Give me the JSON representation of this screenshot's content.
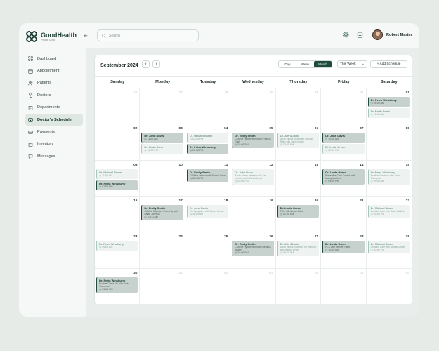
{
  "brand": {
    "name": "GoodHealth",
    "subtitle": "Private Clinic"
  },
  "nav": [
    {
      "label": "Dashboard",
      "icon": "grid-icon"
    },
    {
      "label": "Appointment",
      "icon": "calendar-icon"
    },
    {
      "label": "Patients",
      "icon": "users-icon"
    },
    {
      "label": "Doctors",
      "icon": "stethoscope-icon"
    },
    {
      "label": "Departments",
      "icon": "building-icon"
    },
    {
      "label": "Doctor's Schedule",
      "icon": "schedule-icon",
      "active": true
    },
    {
      "label": "Payments",
      "icon": "card-icon"
    },
    {
      "label": "Inventory",
      "icon": "box-icon"
    },
    {
      "label": "Messages",
      "icon": "chat-icon"
    }
  ],
  "search": {
    "placeholder": "Search"
  },
  "user": {
    "name": "Robert Martin"
  },
  "calendar": {
    "month_label": "September 2024",
    "views": [
      "Day",
      "Week",
      "Month"
    ],
    "active_view": "Month",
    "range_select": "This Week",
    "add_button": "+ Add Schedule",
    "weekdays": [
      "Sunday",
      "Monday",
      "Tuesday",
      "Wednesday",
      "Thursday",
      "Friday",
      "Saturday"
    ],
    "cells": [
      {
        "date": "26",
        "muted": true,
        "events": []
      },
      {
        "date": "27",
        "muted": true,
        "events": []
      },
      {
        "date": "28",
        "muted": true,
        "events": []
      },
      {
        "date": "29",
        "muted": true,
        "events": []
      },
      {
        "date": "30",
        "muted": true,
        "events": []
      },
      {
        "date": "31",
        "muted": true,
        "events": []
      },
      {
        "date": "01",
        "events": [
          {
            "doctor": "Dr. Petra Winsburry",
            "time": "09:00 AM",
            "style": "dark"
          },
          {
            "doctor": "Dr. Emily Smith",
            "time": "10:00 AM",
            "style": "light"
          }
        ]
      },
      {
        "date": "02",
        "events": []
      },
      {
        "date": "03",
        "events": [
          {
            "doctor": "Dr. John Davis",
            "time": "11:00 AM",
            "style": "dark"
          },
          {
            "doctor": "Dr. Linda Green",
            "time": "01:00 PM",
            "style": "light"
          }
        ]
      },
      {
        "date": "04",
        "events": [
          {
            "doctor": "Dr. Michael Brown",
            "time": "02:00 PM",
            "style": "light"
          },
          {
            "doctor": "Dr. Petra Winsburry",
            "time": "03:00 PM",
            "style": "dark"
          }
        ]
      },
      {
        "date": "05",
        "events": [
          {
            "doctor": "Dr. Emily Smith",
            "desc": "CSM for Hypertension with Patricia Clark",
            "time": "04:00 PM",
            "style": "dark"
          }
        ]
      },
      {
        "date": "06",
        "events": [
          {
            "doctor": "Dr. John Davis",
            "desc": "Acute Illness Treatment for Skin Rash with Daniel Lewis",
            "time": "03:00 PM",
            "style": "light"
          }
        ]
      },
      {
        "date": "07",
        "events": [
          {
            "doctor": "Dr. John Davis",
            "time": "10:00 AM",
            "style": "dark"
          },
          {
            "doctor": "Dr. Linda Green",
            "time": "02:00 PM",
            "style": "light"
          }
        ]
      },
      {
        "date": "08",
        "events": []
      },
      {
        "date": "09",
        "events": [
          {
            "doctor": "Dr. Michael Brown",
            "time": "11:00 AM",
            "style": "light"
          },
          {
            "doctor": "Dr. Petra Winsburry",
            "time": "01:00 PM",
            "style": "dark"
          }
        ]
      },
      {
        "date": "10",
        "events": []
      },
      {
        "date": "11",
        "events": [
          {
            "doctor": "Dr. Emily Smith",
            "desc": "CSM for Asthma with Rachel Green",
            "time": "02:00 PM",
            "style": "dark"
          }
        ]
      },
      {
        "date": "12",
        "events": [
          {
            "doctor": "Dr. John Davis",
            "desc": "Acute Illness treatment for Ear Infection with Daniel Lewis",
            "time": "03:00 PM",
            "style": "light"
          }
        ]
      },
      {
        "date": "13",
        "events": []
      },
      {
        "date": "14",
        "events": [
          {
            "doctor": "Dr. Linda Green",
            "desc": "Preventive Care Consul. with Nancy Martinez",
            "time": "04:00 PM",
            "style": "dark"
          }
        ]
      },
      {
        "date": "15",
        "events": [
          {
            "doctor": "Dr. Petra Winsburry",
            "desc": "Routine Check-up with John Thompson",
            "time": "09:00 AM",
            "style": "light"
          }
        ]
      },
      {
        "date": "16",
        "events": []
      },
      {
        "date": "17",
        "events": [
          {
            "doctor": "Dr. Emily Smith",
            "desc": "CSM for Diabetes Check-Up with Sarah Johnson",
            "time": "10:00 AM",
            "style": "dark"
          }
        ]
      },
      {
        "date": "18",
        "events": [
          {
            "doctor": "Dr. John Davis",
            "desc": "Flu Symptoms with James Brown",
            "time": "11:00 AM",
            "style": "light"
          }
        ]
      },
      {
        "date": "19",
        "events": []
      },
      {
        "date": "20",
        "events": [
          {
            "doctor": "Dr. Linda Green",
            "desc": "PCC with Susan Clark",
            "time": "01:00 PM",
            "style": "dark"
          }
        ]
      },
      {
        "date": "21",
        "events": []
      },
      {
        "date": "22",
        "events": [
          {
            "doctor": "Dr. Michael Brown",
            "desc": "Geriatric Care with Robert Wilson",
            "time": "03:00 PM",
            "style": "light"
          }
        ]
      },
      {
        "date": "23",
        "events": [
          {
            "doctor": "Dr. Petra Winsburry",
            "time": "09:00 AM",
            "style": "light"
          }
        ]
      },
      {
        "date": "24",
        "events": []
      },
      {
        "date": "25",
        "events": []
      },
      {
        "date": "26",
        "events": [
          {
            "doctor": "Dr. Emily Smith",
            "desc": "CSM for Hypertension with Jessica Brown",
            "time": "04:00 PM",
            "style": "dark"
          }
        ]
      },
      {
        "date": "27",
        "events": [
          {
            "doctor": "Dr. John Davis",
            "desc": "Acute Illness treatment for Infection with Mariah White",
            "time": "09:00 AM",
            "style": "light"
          }
        ]
      },
      {
        "date": "28",
        "events": [
          {
            "doctor": "Dr. Linda Green",
            "desc": "PCC with Jennifer Harris",
            "time": "10:00 AM",
            "style": "dark"
          }
        ]
      },
      {
        "date": "29",
        "events": [
          {
            "doctor": "Dr. Michael Brown",
            "desc": "Geriatric Care with Barbara Lewis",
            "time": "03:00 PM",
            "style": "light"
          }
        ]
      },
      {
        "date": "30",
        "events": [
          {
            "doctor": "Dr. Petra Winsburry",
            "desc": "Routine Check-Up with David Thompson",
            "time": "01:00 PM",
            "style": "dark"
          }
        ]
      },
      {
        "date": "01",
        "muted": true,
        "events": []
      },
      {
        "date": "02",
        "muted": true,
        "events": []
      },
      {
        "date": "03",
        "muted": true,
        "events": []
      },
      {
        "date": "04",
        "muted": true,
        "events": []
      },
      {
        "date": "05",
        "muted": true,
        "events": []
      },
      {
        "date": "06",
        "muted": true,
        "events": []
      }
    ]
  },
  "colors": {
    "primary": "#1e4d3f",
    "event_dark": "#c7d2ce",
    "event_light": "#eef3f1"
  }
}
